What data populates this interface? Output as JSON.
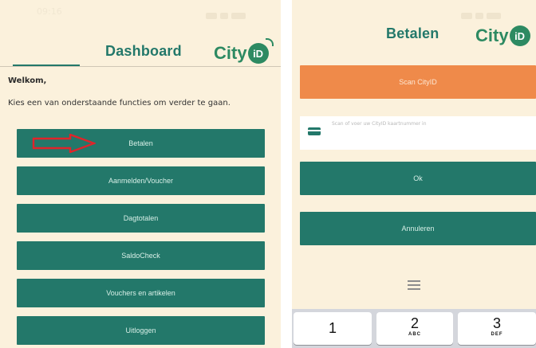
{
  "left_screen": {
    "status_time": "09:16",
    "header": {
      "title": "Dashboard",
      "logo_text": "City",
      "logo_badge": "iD"
    },
    "welcome": "Welkom,",
    "intro": "Kies een van onderstaande functies om verder te gaan.",
    "buttons": [
      {
        "label": "Betalen"
      },
      {
        "label": "Aanmelden/Voucher"
      },
      {
        "label": "Dagtotalen"
      },
      {
        "label": "SaldoCheck"
      },
      {
        "label": "Vouchers en artikelen"
      },
      {
        "label": "Uitloggen"
      }
    ],
    "annotation_color": "#e0242a"
  },
  "right_screen": {
    "header": {
      "title": "Betalen",
      "logo_text": "City",
      "logo_badge": "iD"
    },
    "scan_button": "Scan CityID",
    "card_input_placeholder": "Scan of voer uw CityID kaartnummer in",
    "ok_button": "Ok",
    "cancel_button": "Annuleren",
    "keyboard": [
      {
        "number": "1",
        "letters": ""
      },
      {
        "number": "2",
        "letters": "ABC"
      },
      {
        "number": "3",
        "letters": "DEF"
      }
    ]
  },
  "colors": {
    "background": "#fbf1dc",
    "primary_button": "#23786a",
    "scan_button": "#ef8a4a",
    "logo": "#2d8a62"
  }
}
